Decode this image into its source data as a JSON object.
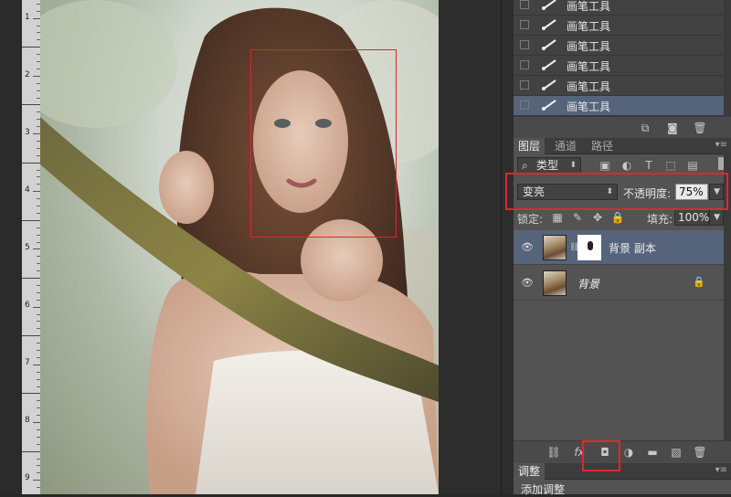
{
  "ruler": {
    "numbers": [
      "1",
      "2",
      "3",
      "4",
      "5",
      "6",
      "7",
      "8",
      "9"
    ]
  },
  "history": {
    "items": [
      {
        "label": "画笔工具",
        "selected": false
      },
      {
        "label": "画笔工具",
        "selected": false
      },
      {
        "label": "画笔工具",
        "selected": false
      },
      {
        "label": "画笔工具",
        "selected": false
      },
      {
        "label": "画笔工具",
        "selected": false
      },
      {
        "label": "画笔工具",
        "selected": true
      }
    ]
  },
  "layers_panel": {
    "tabs": [
      "图层",
      "通道",
      "路径"
    ],
    "filter_label": "类型",
    "blend_mode": "变亮",
    "opacity_label": "不透明度:",
    "opacity_value": "75%",
    "lock_label": "锁定:",
    "fill_label": "填充:",
    "fill_value": "100%",
    "layers": [
      {
        "name": "背景 副本",
        "selected": true,
        "has_mask": true
      },
      {
        "name": "背景",
        "selected": false,
        "locked": true
      }
    ]
  },
  "adjust_panel": {
    "tab": "调整",
    "add_label": "添加调整"
  },
  "colors": {
    "accent_red": "#e1262d",
    "selected_row": "#56647b",
    "panel_bg": "#535353"
  }
}
